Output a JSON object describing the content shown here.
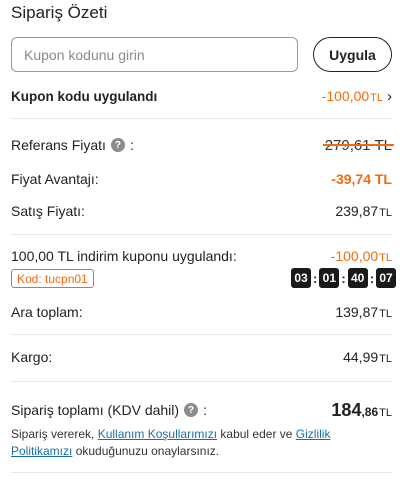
{
  "summary": {
    "title": "Sipariş Özeti"
  },
  "coupon": {
    "placeholder": "Kupon kodunu girin",
    "apply_label": "Uygula",
    "applied_label": "Kupon kodu uygulandı",
    "applied_value": "-100,00",
    "applied_currency": "TL"
  },
  "prices": {
    "reference_label": "Referans Fiyatı",
    "reference_value": "279,61 TL",
    "advantage_label": "Fiyat Avantajı:",
    "advantage_value": "-39,74 TL",
    "sale_label": "Satış Fiyatı:",
    "sale_value": "239,87",
    "sale_currency": "TL"
  },
  "discount": {
    "label": "100,00 TL indirim kuponu uygulandı:",
    "value": "-100,00",
    "currency": "TL",
    "code": "Kod: tucpn01",
    "timer": [
      "03",
      "01",
      "40",
      "07"
    ]
  },
  "subtotal": {
    "label": "Ara toplam:",
    "value": "139,87",
    "currency": "TL"
  },
  "shipping": {
    "label": "Kargo:",
    "value": "44,99",
    "currency": "TL"
  },
  "total": {
    "label": "Sipariş toplamı (KDV dahil)",
    "colon": ":",
    "value_main": "184",
    "value_decimal": ",86",
    "currency": "TL"
  },
  "legal": {
    "prefix": "Sipariş vererek, ",
    "terms_link": "Kullanım Koşullarımızı",
    "middle": " kabul eder ve ",
    "privacy_link": "Gizlilik Politikamızı",
    "suffix": " okuduğunuzu onaylarsınız."
  },
  "icons": {
    "help": "help-circle-icon",
    "chevron": "chevron-right-icon"
  },
  "colors": {
    "accent": "#f26a10",
    "link": "#1a6fa8",
    "timer_bg": "#1a1a1a"
  }
}
